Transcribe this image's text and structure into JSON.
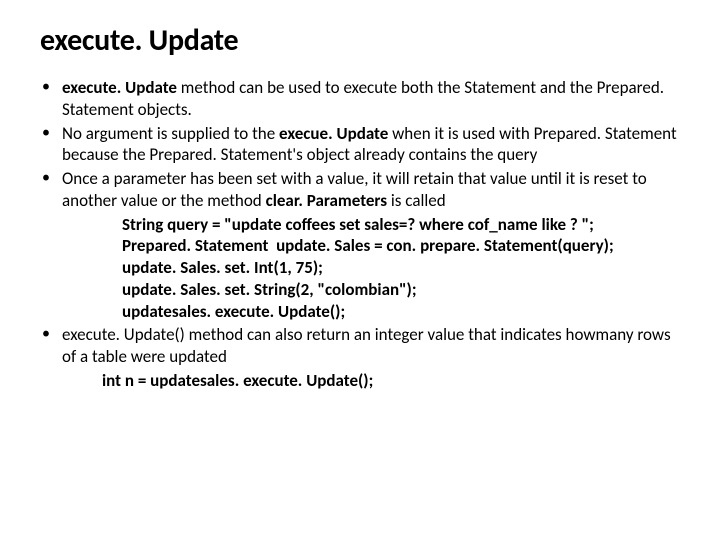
{
  "title": "execute. Update",
  "bullets": [
    {
      "bold_lead": "execute. Update ",
      "text": "method can be used to execute both the Statement and the Prepared. Statement objects."
    },
    {
      "pre": "No argument is supplied to the ",
      "bold_mid": "execue. Update",
      "post": " when it is used with Prepared. Statement  because the Prepared. Statement's  object  already contains the query"
    },
    {
      "pre": "Once a parameter has been set with a value, it will retain that value until it is reset to another value or the method ",
      "bold_mid": "clear. Parameters",
      "post": " is called"
    },
    {
      "text": "execute. Update() method  can also return an integer value that indicates howmany rows of a table were updated"
    }
  ],
  "code1": [
    "String query = \"update coffees set sales=? where cof_name like ? \";",
    "Prepared. Statement  update. Sales = con. prepare. Statement(query);",
    "update. Sales. set. Int(1, 75);",
    "update. Sales. set. String(2, \"colombian\");",
    "updatesales. execute. Update();"
  ],
  "code2": "int  n = updatesales. execute. Update();"
}
